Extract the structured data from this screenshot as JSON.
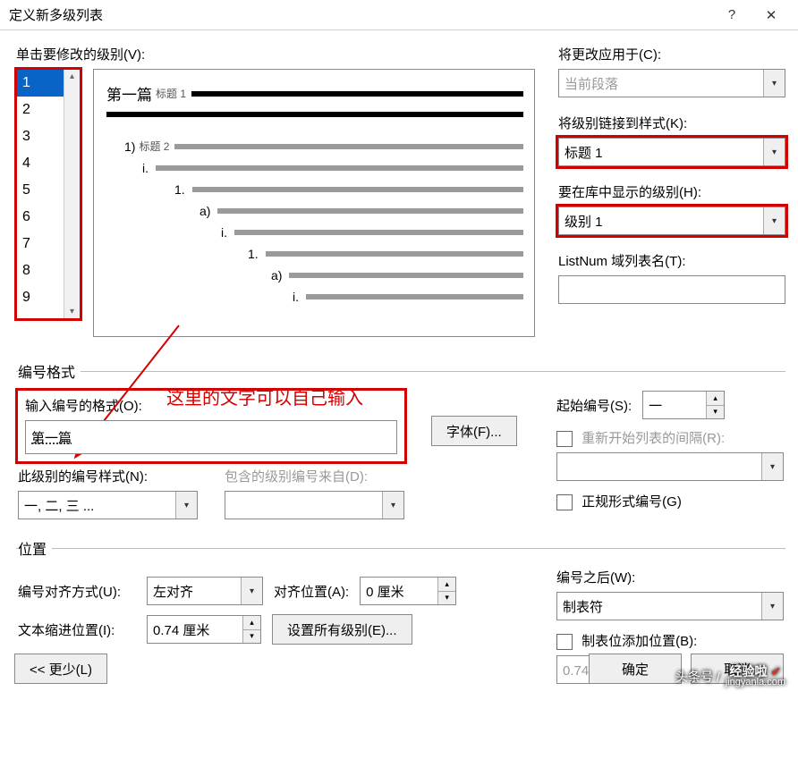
{
  "window": {
    "title": "定义新多级列表",
    "help_icon": "?",
    "close_icon": "✕"
  },
  "level_section": {
    "label": "单击要修改的级别(V):",
    "items": [
      "1",
      "2",
      "3",
      "4",
      "5",
      "6",
      "7",
      "8",
      "9"
    ],
    "selected": "1"
  },
  "preview": {
    "l1_num": "第一篇",
    "l1_h": "标题 1",
    "l2_num": "1)",
    "l2_h": "标题 2",
    "l3_num": "i.",
    "l4_num": "1.",
    "l5_num": "a)",
    "l6_num": "i.",
    "l7_num": "1.",
    "l8_num": "a)",
    "l9_num": "i."
  },
  "right": {
    "apply_to_label": "将更改应用于(C):",
    "apply_to_value": "当前段落",
    "link_style_label": "将级别链接到样式(K):",
    "link_style_value": "标题 1",
    "gallery_level_label": "要在库中显示的级别(H):",
    "gallery_level_value": "级别 1",
    "listnum_label": "ListNum 域列表名(T):",
    "listnum_value": ""
  },
  "annotation": "这里的文字可以自己输入",
  "number_format": {
    "legend": "编号格式",
    "enter_label": "输入编号的格式(O):",
    "enter_value": "第一篇",
    "font_button": "字体(F)...",
    "style_label": "此级别的编号样式(N):",
    "style_value": "一, 二, 三 ...",
    "include_label": "包含的级别编号来自(D):",
    "include_value": "",
    "start_label": "起始编号(S):",
    "start_value": "一",
    "restart_label": "重新开始列表的间隔(R):",
    "restart_value": "",
    "legal_label": "正规形式编号(G)"
  },
  "position": {
    "legend": "位置",
    "align_label": "编号对齐方式(U):",
    "align_value": "左对齐",
    "align_at_label": "对齐位置(A):",
    "align_at_value": "0 厘米",
    "follow_label": "编号之后(W):",
    "follow_value": "制表符",
    "indent_label": "文本缩进位置(I):",
    "indent_value": "0.74 厘米",
    "set_all_button": "设置所有级别(E)...",
    "tab_stop_label": "制表位添加位置(B):",
    "tab_stop_value": "0.74 厘米"
  },
  "footer": {
    "less": "<< 更少(L)",
    "ok": "确定",
    "cancel": "取消"
  },
  "watermark": {
    "line1": "头条号 /",
    "brand": "经验啦",
    "url": "jingyanla.com"
  }
}
